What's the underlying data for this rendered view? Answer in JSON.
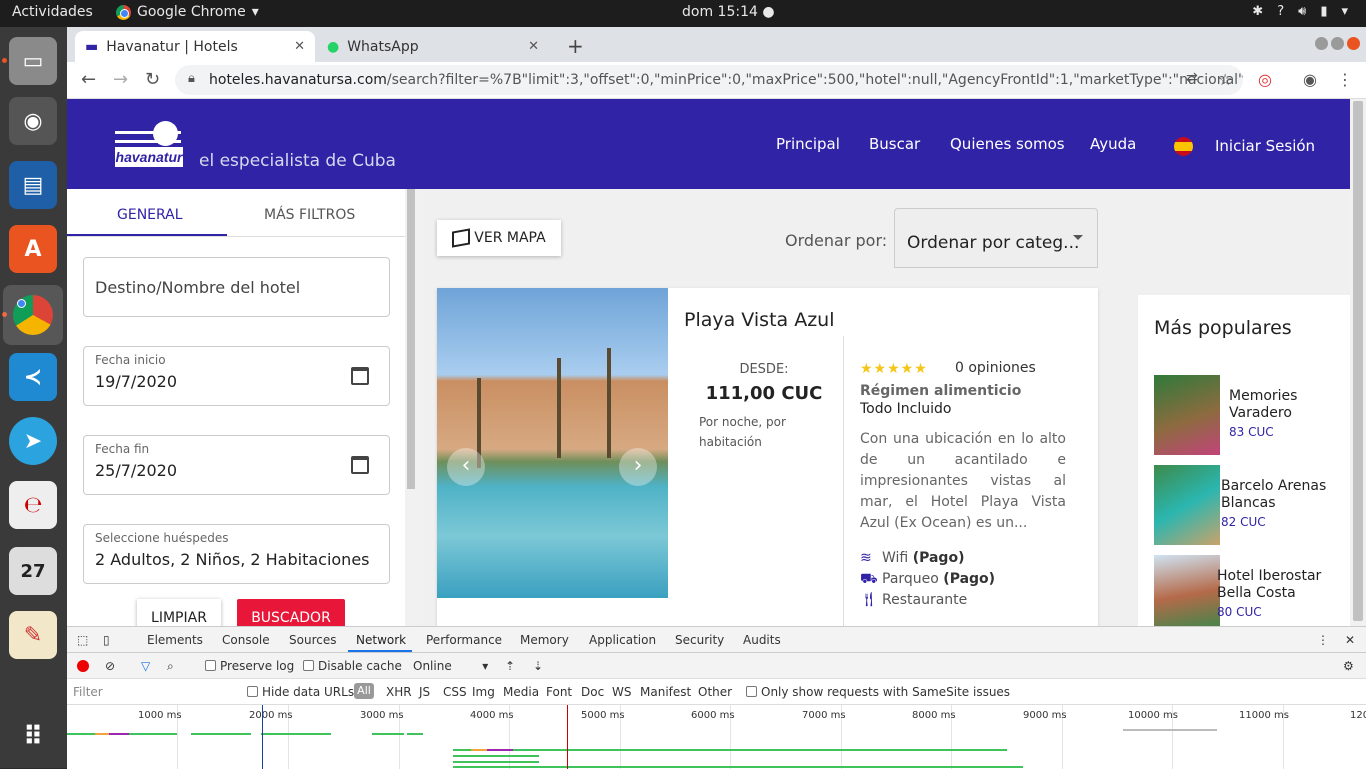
{
  "os": {
    "activities": "Actividades",
    "app_name": "Google Chrome",
    "clock": "dom 15:14",
    "calendar_day": "27"
  },
  "browser": {
    "tabs": [
      {
        "label": "Havanatur | Hotels",
        "active": true
      },
      {
        "label": "WhatsApp",
        "active": false
      }
    ],
    "url_host": "hoteles.havanatursa.com",
    "url_rest": "/search?filter=%7B\"limit\":3,\"offset\":0,\"minPrice\":0,\"maxPrice\":500,\"hotel\":null,\"AgencyFrontId\":1,\"marketType\":\"nacional\",\"..."
  },
  "site": {
    "logo_text": "havanatur",
    "tagline": "el especialista de Cuba",
    "nav": [
      "Principal",
      "Buscar",
      "Quienes somos",
      "Ayuda"
    ],
    "login": "Iniciar Sesión",
    "brand_color": "#3023a6"
  },
  "filters": {
    "tabs": [
      "GENERAL",
      "MÁS FILTROS"
    ],
    "destination_placeholder": "Destino/Nombre del hotel",
    "start_label": "Fecha inicio",
    "start_value": "19/7/2020",
    "end_label": "Fecha fin",
    "end_value": "25/7/2020",
    "guests_label": "Seleccione huéspedes",
    "guests_value": "2 Adultos, 2 Niños, 2 Habitaciones",
    "clear": "LIMPIAR",
    "search": "BUSCADOR"
  },
  "results": {
    "map_button": "VER MAPA",
    "order_label": "Ordenar por:",
    "order_value": "Ordenar por categ...",
    "hotel": {
      "name": "Playa Vista Azul",
      "desde": "DESDE:",
      "price": "111,00 CUC",
      "per_night": "Por noche, por habitación",
      "stars": "★★★★★",
      "opinions": "0 opiniones",
      "regimen_label": "Régimen alimenticio",
      "regimen_value": "Todo Incluido",
      "description": "Con una ubicación en lo alto de un acantilado e impresionantes vistas al mar, el Hotel Playa Vista Azul (Ex Ocean) es un...",
      "amenities": [
        {
          "icon": "wifi-icon",
          "name": "Wifi",
          "note": "(Pago)"
        },
        {
          "icon": "car-icon",
          "name": "Parqueo",
          "note": "(Pago)"
        },
        {
          "icon": "restaurant-icon",
          "name": "Restaurante",
          "note": ""
        }
      ]
    }
  },
  "popular": {
    "title": "Más populares",
    "items": [
      {
        "name": "Memories Varadero",
        "price": "83 CUC"
      },
      {
        "name": "Barcelo Arenas Blancas",
        "price": "82 CUC"
      },
      {
        "name": "Hotel Iberostar Bella Costa",
        "price": "80 CUC"
      }
    ]
  },
  "devtools": {
    "tabs": [
      "Elements",
      "Console",
      "Sources",
      "Network",
      "Performance",
      "Memory",
      "Application",
      "Security",
      "Audits"
    ],
    "active_tab": "Network",
    "preserve_log": "Preserve log",
    "disable_cache": "Disable cache",
    "throttle": "Online",
    "filter_placeholder": "Filter",
    "hide_data_urls": "Hide data URLs",
    "types": [
      "All",
      "XHR",
      "JS",
      "CSS",
      "Img",
      "Media",
      "Font",
      "Doc",
      "WS",
      "Manifest",
      "Other"
    ],
    "samesite": "Only show requests with SameSite issues",
    "ticks": [
      "1000 ms",
      "2000 ms",
      "3000 ms",
      "4000 ms",
      "5000 ms",
      "6000 ms",
      "7000 ms",
      "8000 ms",
      "9000 ms",
      "10000 ms",
      "11000 ms",
      "120"
    ]
  }
}
